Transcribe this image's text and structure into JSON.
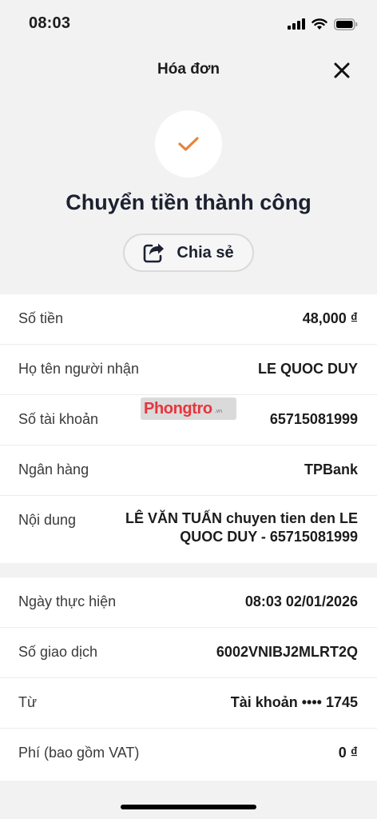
{
  "status_bar": {
    "time": "08:03"
  },
  "header": {
    "title": "Hóa đơn"
  },
  "success": {
    "title": "Chuyển tiền thành công",
    "share_label": "Chia sẻ"
  },
  "details": [
    {
      "label": "Số tiền",
      "value": "48,000 ₫"
    },
    {
      "label": "Họ tên người nhận",
      "value": "LE QUOC DUY"
    },
    {
      "label": "Số tài khoản",
      "value": "65715081999"
    },
    {
      "label": "Ngân hàng",
      "value": "TPBank"
    },
    {
      "label": "Nội dung",
      "value": "LÊ VĂN TUẤN chuyen tien den LE QUOC DUY - 65715081999"
    }
  ],
  "transaction": [
    {
      "label": "Ngày thực hiện",
      "value": "08:03 02/01/2026"
    },
    {
      "label": "Số giao dịch",
      "value": "6002VNIBJ2MLRT2Q"
    },
    {
      "label": "Từ",
      "value": "Tài khoản •••• 1745"
    },
    {
      "label": "Phí (bao gồm VAT)",
      "value": "0 ₫"
    }
  ],
  "watermark": {
    "text": "Phongtro",
    "suffix": ".vn"
  },
  "colors": {
    "accent": "#e8823a",
    "background": "#f2f2f2",
    "card": "#ffffff"
  },
  "icons": [
    "signal-icon",
    "wifi-icon",
    "battery-icon",
    "close-icon",
    "checkmark-icon",
    "share-icon"
  ]
}
